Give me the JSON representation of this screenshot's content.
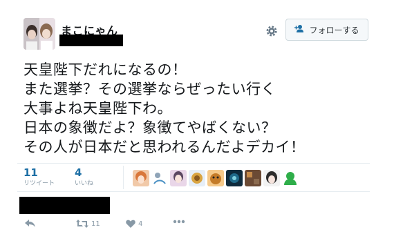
{
  "user": {
    "display_name": "まこにゃん"
  },
  "header": {
    "follow_label": "フォローする",
    "settings_icon": "gear-icon",
    "follow_icon": "person-add-icon"
  },
  "tweet": {
    "lines": [
      "天皇陛下だれになるの！",
      "また選挙？その選挙ならぜったい行く",
      "大事よね天皇陛下わ。",
      "日本の象徴だよ？象徴てやばくない？",
      "その人が日本だと思われるんだよデカイ！"
    ]
  },
  "stats": {
    "retweets": "11",
    "retweets_label": "リツイート",
    "likes": "4",
    "likes_label": "いいね"
  },
  "actions": {
    "retweet_count": "11",
    "like_count": "4",
    "icons": [
      "reply-icon",
      "retweet-icon",
      "heart-icon",
      "more-icon"
    ]
  },
  "colors": {
    "accent": "#1d6fa5",
    "muted": "#8899a6",
    "border": "#e6ecf0"
  }
}
